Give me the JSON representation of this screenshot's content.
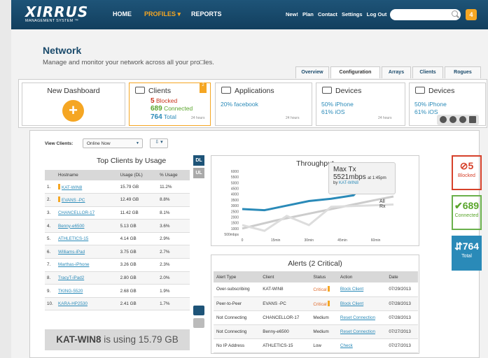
{
  "header": {
    "logo": "XIRRUS",
    "logo_sub": "MANAGEMENT SYSTEM ™",
    "nav": [
      "HOME",
      "PROFILES ▾",
      "REPORTS"
    ],
    "links": [
      "New!",
      "Plan",
      "Contact",
      "Settings",
      "Log Out"
    ],
    "search_placeholder": "",
    "badge": "4"
  },
  "page": {
    "title": "Network",
    "subtitle": "Manage and monitor your network across all your pro□les.",
    "tabs": [
      "Overview",
      "Configuration",
      "Arrays",
      "Clients",
      "Rogues"
    ]
  },
  "cards": {
    "dashboard": "New Dashboard",
    "clients": {
      "title": "Clients",
      "badge": "2",
      "blocked": "5",
      "blocked_label": "Blocked",
      "connected": "689",
      "connected_label": "Connected",
      "total": "764",
      "total_label": "Total",
      "range": "24 hours"
    },
    "apps": {
      "title": "Applications",
      "stat": "20% facebook",
      "range": "24 hours"
    },
    "devices1": {
      "title": "Devices",
      "stat1": "50% iPhone",
      "stat2": "61% iOS",
      "range": "24 hours"
    },
    "devices2": {
      "title": "Devices",
      "stat1": "50% iPhone",
      "stat2": "61% iOS"
    }
  },
  "filter": {
    "label": "View Clients:",
    "selected": "Online Now"
  },
  "top_clients": {
    "title": "Top Clients by Usage",
    "dl": "DL",
    "ul": "UL",
    "headers": [
      "Hostname",
      "Usage (DL)",
      "% Usage"
    ],
    "rows": [
      [
        "1.",
        "KAT-WIN8",
        "15.79 GB",
        "11.2%"
      ],
      [
        "2.",
        "EVANS -PC",
        "12.49 GB",
        "8.8%"
      ],
      [
        "3.",
        "CHANCELLOR-17",
        "11.42 GB",
        "8.1%"
      ],
      [
        "4.",
        "Benny-e6500",
        "5.13 GB",
        "3.6%"
      ],
      [
        "5.",
        "ATHLETICS-15",
        "4.14 GB",
        "2.9%"
      ],
      [
        "6.",
        "Williams-iPad",
        "3.75 GB",
        "2.7%"
      ],
      [
        "7.",
        "Marthas-iPhone",
        "3.26 GB",
        "2.3%"
      ],
      [
        "8.",
        "TracyT-iPad2",
        "2.80 GB",
        "2.0%"
      ],
      [
        "9.",
        "TKING-5520",
        "2.68 GB",
        "1.9%"
      ],
      [
        "10.",
        "KARA-HP2530",
        "2.41 GB",
        "1.7%"
      ]
    ],
    "usage_host": "KAT-WIN8",
    "usage_text": " is using 15.79 GB"
  },
  "chart_data": {
    "type": "line",
    "title": "Throughput",
    "x": [
      0,
      15,
      30,
      45,
      60
    ],
    "xtick_labels": [
      "0",
      "15min",
      "30min",
      "45min",
      "60min"
    ],
    "ylabel": "",
    "ylim": [
      500,
      6000
    ],
    "yticks": [
      "500mbps",
      "1000",
      "1500",
      "2000",
      "2500",
      "3000",
      "3500",
      "4000",
      "4500",
      "5000",
      "5500",
      "6000"
    ],
    "series": [
      {
        "name": "",
        "color": "#2a8ab8",
        "points": [
          [
            0,
            2700
          ],
          [
            10,
            2600
          ],
          [
            20,
            3000
          ],
          [
            30,
            3400
          ],
          [
            40,
            3600
          ],
          [
            50,
            3900
          ],
          [
            55,
            4900
          ],
          [
            60,
            5521
          ],
          [
            63,
            4700
          ],
          [
            68,
            4800
          ]
        ]
      },
      {
        "name": "All",
        "color": "#cccccc",
        "points": [
          [
            0,
            1000
          ],
          [
            15,
            1700
          ],
          [
            30,
            2300
          ],
          [
            45,
            2900
          ],
          [
            60,
            3500
          ],
          [
            68,
            3800
          ]
        ]
      },
      {
        "name": "Rx",
        "color": "#dddddd",
        "points": [
          [
            0,
            1300
          ],
          [
            10,
            800
          ],
          [
            20,
            2100
          ],
          [
            30,
            1300
          ],
          [
            40,
            2900
          ],
          [
            55,
            3000
          ],
          [
            68,
            3100
          ]
        ]
      }
    ],
    "tooltip": {
      "title": "Max Tx",
      "value": "5521mbps",
      "time": "at 1:45pm",
      "by_label": "by ",
      "by_host": "KAT-WIN8"
    }
  },
  "kpis": {
    "blocked": "5",
    "blocked_label": "Blocked",
    "connected": "689",
    "connected_label": "Connected",
    "total": "764",
    "total_label": "Total"
  },
  "alerts": {
    "title": "Alerts (2 Critical)",
    "headers": [
      "Alert Type",
      "Client",
      "Status",
      "Action",
      "Date"
    ],
    "rows": [
      [
        "Over-subscribing",
        "KAT-WIN8",
        "Critical",
        "Block Client",
        "07/29/2013"
      ],
      [
        "Peer-to-Peer",
        "EVANS -PC",
        "Critical",
        "Block Client",
        "07/28/2013"
      ],
      [
        "Not Connecting",
        "CHANCELLOR-17",
        "Medium",
        "Reset Connection",
        "07/28/2013"
      ],
      [
        "Not Connecting",
        "Benny-e6500",
        "Medium",
        "Reset Connection",
        "07/27/2013"
      ],
      [
        "No IP Address",
        "ATHLETICS-15",
        "Low",
        "Check",
        "07/27/2013"
      ]
    ]
  }
}
